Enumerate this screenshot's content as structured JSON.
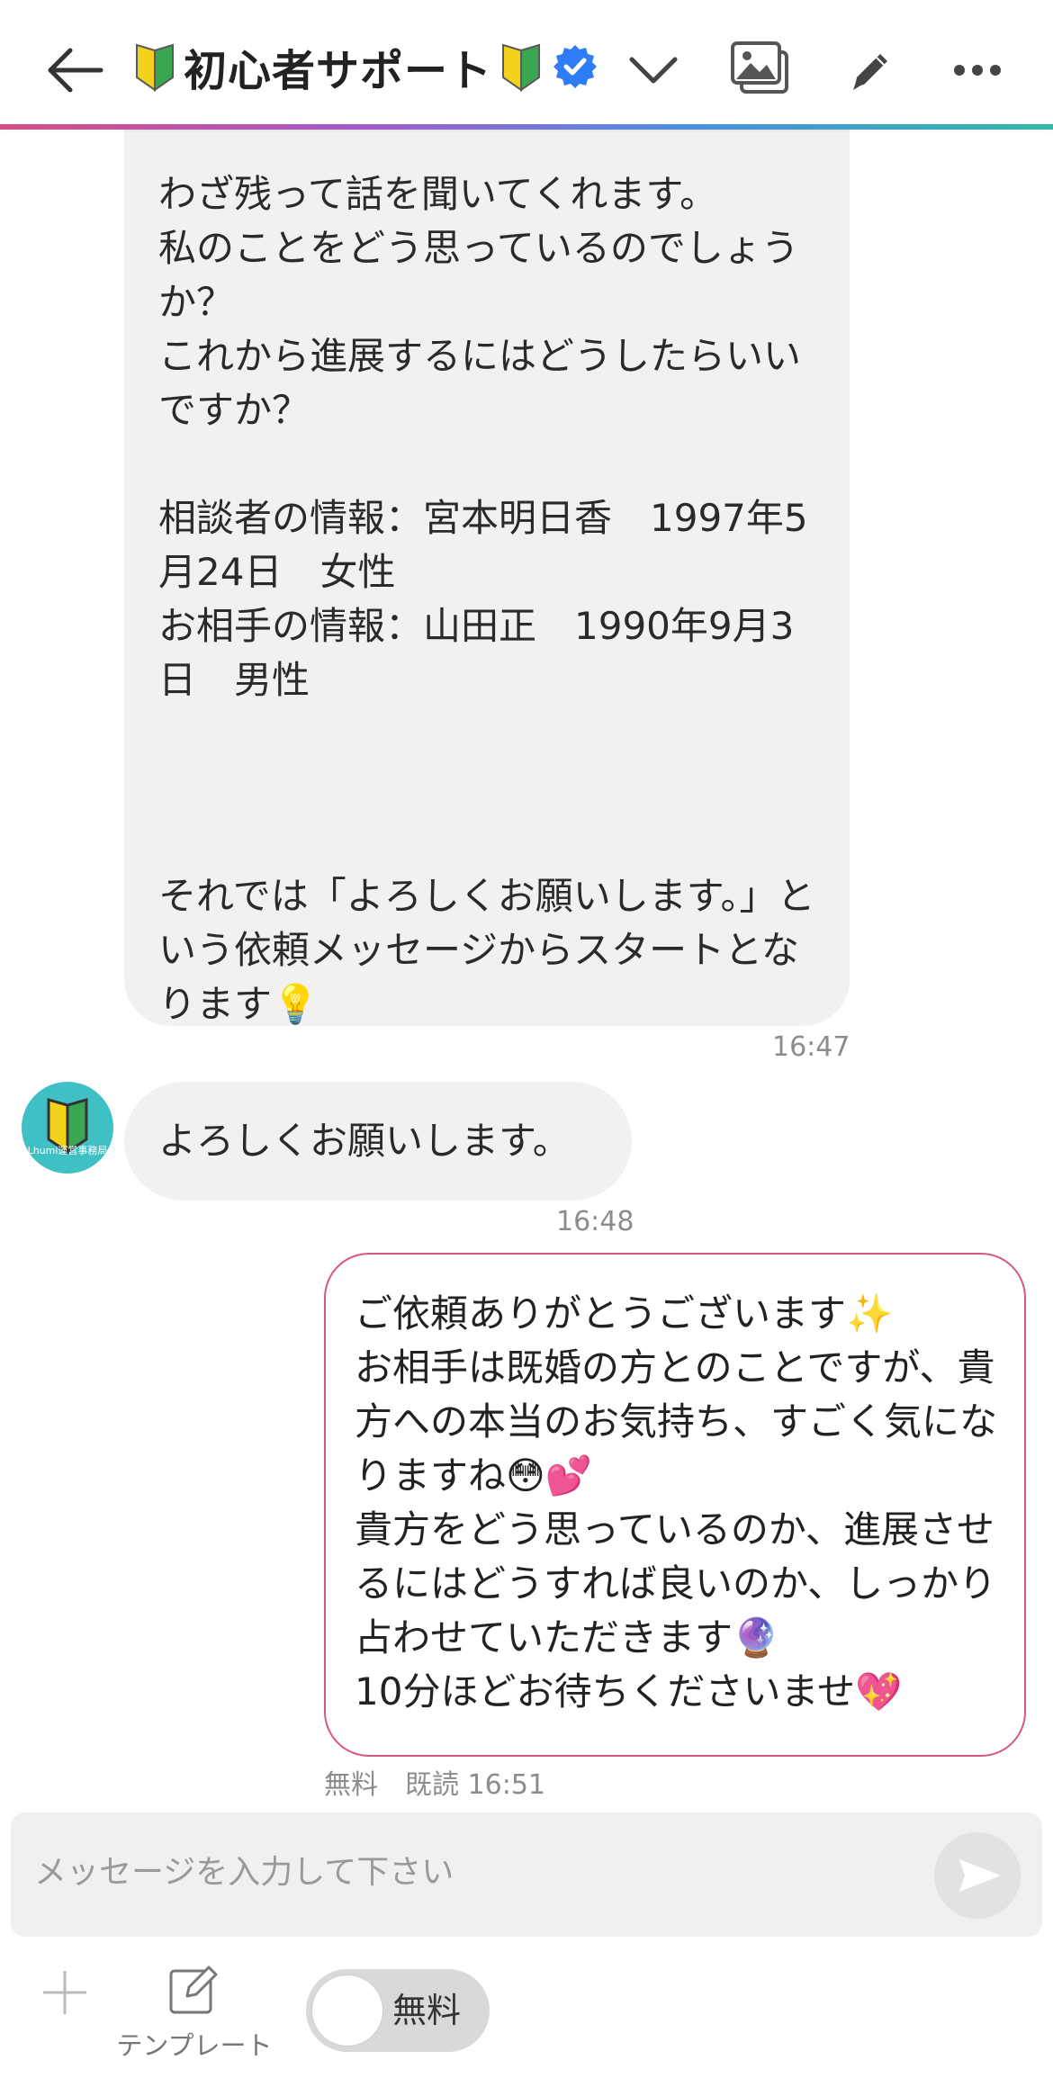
{
  "header": {
    "title": "初心者サポート",
    "back_icon": "back-arrow-icon",
    "chevron_icon": "chevron-down-icon",
    "gallery_icon": "gallery-icon",
    "edit_icon": "edit-icon",
    "more_icon": "more-icon",
    "accent_colors": [
      "#d64f86",
      "#a35cc9",
      "#4d8ee0",
      "#33b8a6"
    ]
  },
  "messages": [
    {
      "direction": "incoming",
      "text": "わざ残って話を聞いてくれます。\n私のことをどう思っているのでしょうか？\nこれから進展するにはどうしたらいいですか？\n\n相談者の情報：宮本明日香　1997年5月24日　女性\nお相手の情報：山田正　1990年9月3日　男性\n\n\n\nそれでは「よろしくお願いします。」という依頼メッセージからスタートとなります💡",
      "time": "16:47"
    },
    {
      "direction": "incoming",
      "avatar_caption": "Lhumi運営事務局",
      "text": "よろしくお願いします。",
      "time": "16:48"
    },
    {
      "direction": "outgoing",
      "text": "ご依頼ありがとうございます✨\nお相手は既婚の方とのことですが、貴方への本当のお気持ち、すごく気になりますね😳💕\n貴方をどう思っているのか、進展させるにはどうすれば良いのか、しっかり占わせていただきます🔮\n10分ほどお待ちくださいませ💖",
      "status": "無料　既読  16:51"
    }
  ],
  "composer": {
    "placeholder": "メッセージを入力して下さい",
    "send_icon": "send-icon",
    "plus_icon": "plus-icon",
    "template_label": "テンプレート",
    "toggle_label": "無料",
    "toggle_on": false
  }
}
